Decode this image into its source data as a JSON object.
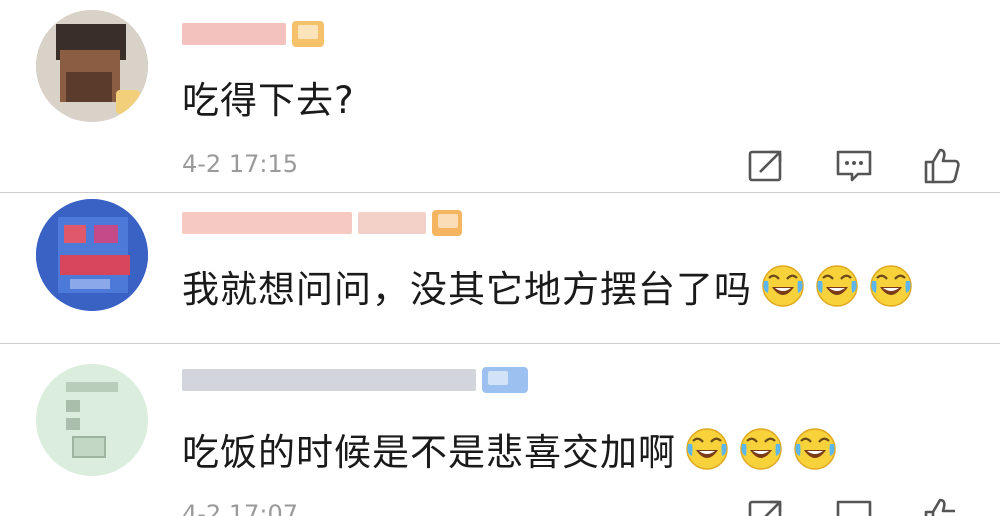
{
  "comments": [
    {
      "text": "吃得下去?",
      "timestamp": "4-2 17:15",
      "emojis": []
    },
    {
      "text": "我就想问问，没其它地方摆台了吗",
      "timestamp": "",
      "emojis": [
        "laugh-cry-emoji",
        "laugh-cry-emoji",
        "laugh-cry-emoji"
      ]
    },
    {
      "text": "吃饭的时候是不是悲喜交加啊",
      "timestamp": "4-2 17:07",
      "emojis": [
        "laugh-cry-emoji",
        "laugh-cry-emoji",
        "laugh-cry-emoji"
      ]
    }
  ],
  "icons": {
    "share": "share-icon",
    "reply": "comment-icon",
    "like": "thumbs-up-icon"
  },
  "colors": {
    "text": "#1a1a1a",
    "meta": "#9a9a9a",
    "divider": "#cfcfcf",
    "vip_gold": "#f5c26b",
    "vip_blue": "#9cc0f0"
  }
}
